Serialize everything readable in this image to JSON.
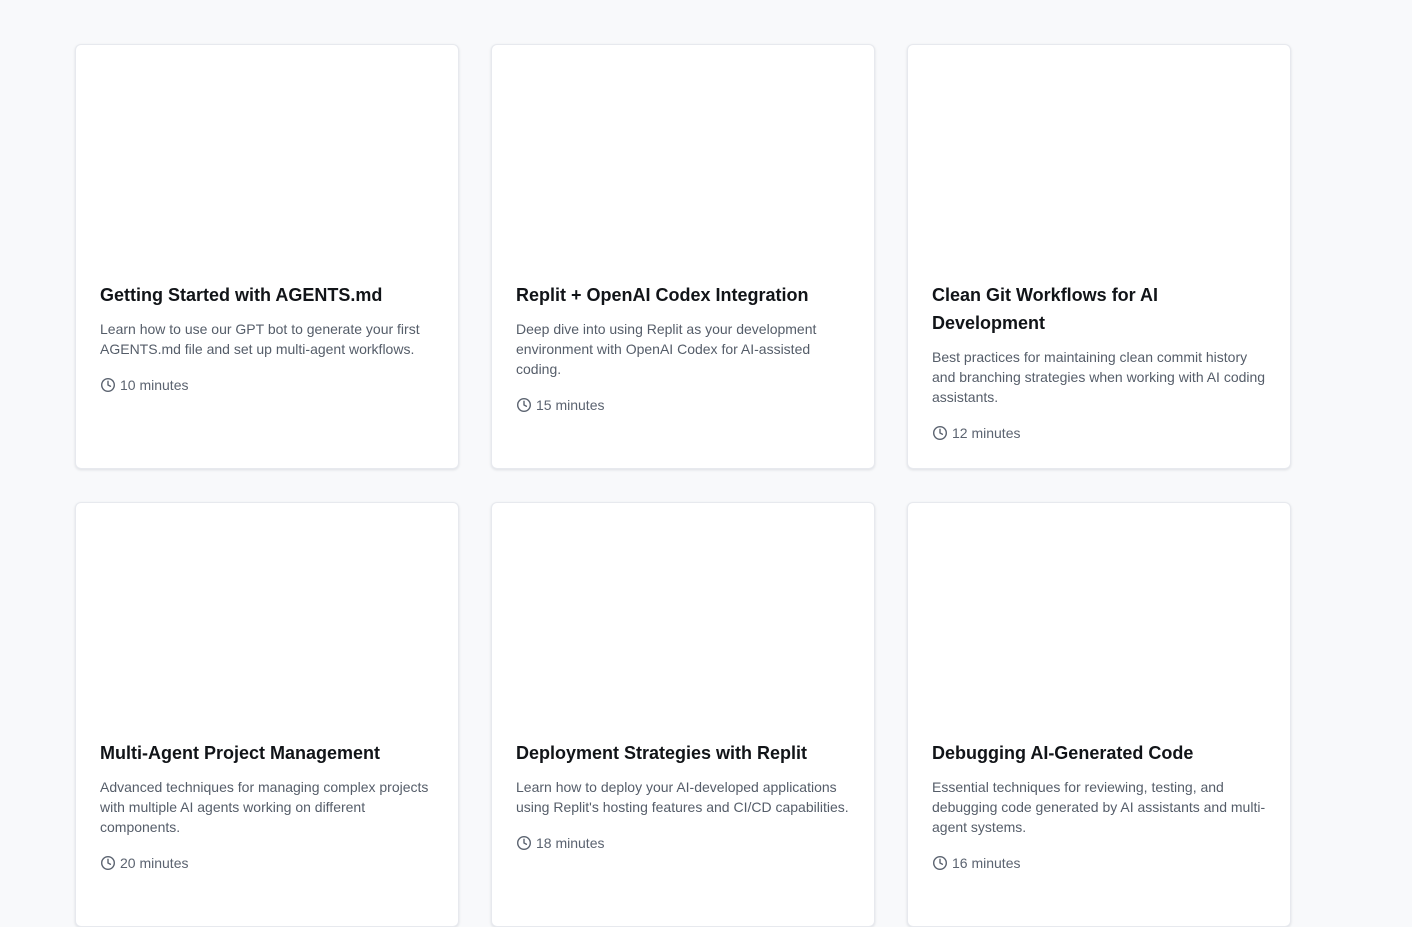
{
  "courses": [
    {
      "title": "Getting Started with AGENTS.md",
      "description": "Learn how to use our GPT bot to generate your first AGENTS.md file and set up multi-agent workflows.",
      "duration": "10 minutes"
    },
    {
      "title": "Replit + OpenAI Codex Integration",
      "description": "Deep dive into using Replit as your development environment with OpenAI Codex for AI-assisted coding.",
      "duration": "15 minutes"
    },
    {
      "title": "Clean Git Workflows for AI Development",
      "description": "Best practices for maintaining clean commit history and branching strategies when working with AI coding assistants.",
      "duration": "12 minutes"
    },
    {
      "title": "Multi-Agent Project Management",
      "description": "Advanced techniques for managing complex projects with multiple AI agents working on different components.",
      "duration": "20 minutes"
    },
    {
      "title": "Deployment Strategies with Replit",
      "description": "Learn how to deploy your AI-developed applications using Replit's hosting features and CI/CD capabilities.",
      "duration": "18 minutes"
    },
    {
      "title": "Debugging AI-Generated Code",
      "description": "Essential techniques for reviewing, testing, and debugging code generated by AI assistants and multi-agent systems.",
      "duration": "16 minutes"
    }
  ],
  "icons": {
    "duration": "clock-icon"
  },
  "colors": {
    "page_background": "#f8f9fb",
    "card_background": "#ffffff",
    "title_text": "#111418",
    "body_text": "#555d69"
  }
}
